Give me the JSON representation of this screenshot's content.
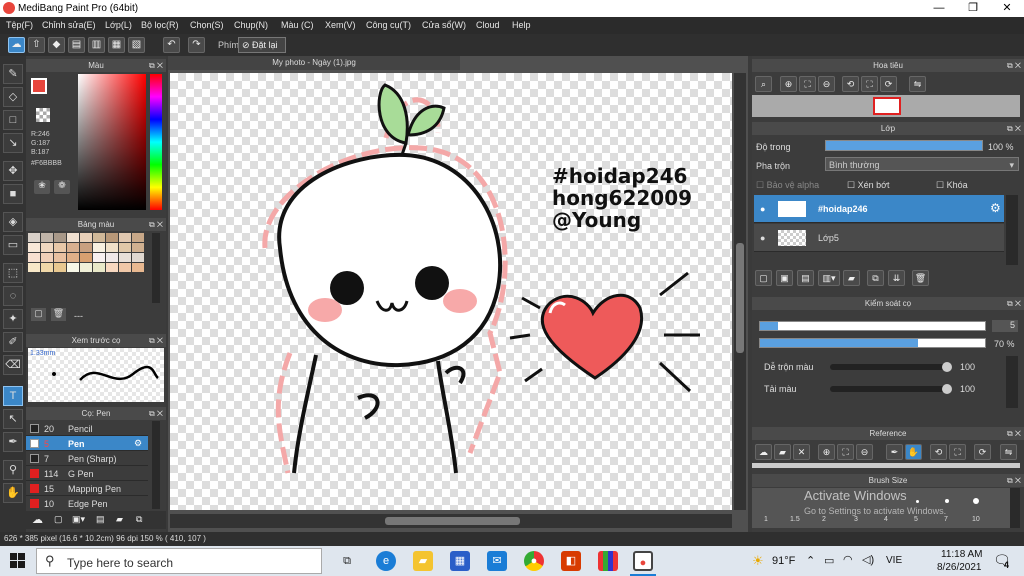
{
  "title": "MediBang Paint Pro (64bit)",
  "menu": [
    "Tệp(F)",
    "Chỉnh sửa(E)",
    "Lớp(L)",
    "Bộ lọc(R)",
    "Chọn(S)",
    "Chụp(N)",
    "Màu (C)",
    "Xem(V)",
    "Công cụ(T)",
    "Cửa sổ(W)",
    "Cloud",
    "Help"
  ],
  "toolbar": {
    "phim_label": "Phím",
    "reset_label": "Đặt lại"
  },
  "color_panel": {
    "title": "Màu",
    "rgb": [
      "R:246",
      "G:187",
      "B:187"
    ],
    "hex": "#F6BBBB",
    "main_color": "#e8453c"
  },
  "palette_panel": {
    "title": "Bảng màu",
    "dash": "---"
  },
  "preview_panel": {
    "title": "Xem trước cọ",
    "size": "1.33mm"
  },
  "brush_list": {
    "title": "Cọ: Pen",
    "items": [
      {
        "size": "20",
        "name": "Pencil",
        "color": "#222"
      },
      {
        "size": "5",
        "name": "Pen",
        "color": "#3b87c8",
        "selected": true
      },
      {
        "size": "7",
        "name": "Pen (Sharp)",
        "color": "#222"
      },
      {
        "size": "114",
        "name": "G Pen",
        "color": "#e02020"
      },
      {
        "size": "15",
        "name": "Mapping Pen",
        "color": "#e02020"
      },
      {
        "size": "10",
        "name": "Edge Pen",
        "color": "#e02020"
      }
    ]
  },
  "document": {
    "tab": "My photo - Ngày (1).jpg"
  },
  "artwork": {
    "lines": [
      "#hoidap246",
      "hong622009",
      "@Young"
    ]
  },
  "navigator": {
    "title": "Hoa tiêu"
  },
  "layer_panel": {
    "title": "Lớp",
    "opacity_label": "Độ trong",
    "opacity_value": "100 %",
    "blend_label": "Pha trộn",
    "blend_value": "Bình thường",
    "protect_alpha": "Bảo vệ alpha",
    "clip": "Xén bớt",
    "lock": "Khóa",
    "layers": [
      {
        "name": "#hoidap246",
        "selected": true
      },
      {
        "name": "Lớp5",
        "selected": false
      }
    ]
  },
  "brush_control": {
    "title": "Kiểm soát cọ",
    "size_value": "5",
    "opacity_value": "70 %",
    "mix_label": "Dễ trộn màu",
    "mix_value": "100",
    "paint_label": "Tải màu",
    "paint_value": "100"
  },
  "reference": {
    "title": "Reference"
  },
  "brush_size": {
    "title": "Brush Size",
    "sizes": [
      "1",
      "1.5",
      "2",
      "3",
      "4",
      "5",
      "7",
      "10"
    ]
  },
  "watermark": {
    "line1": "Activate Windows",
    "line2": "Go to Settings to activate Windows."
  },
  "status": {
    "text": "626 * 385 pixel   (16.6 * 10.2cm)   96 dpi   150 %   ( 410, 107 )"
  },
  "taskbar": {
    "search": "Type here to search",
    "weather": "91°F",
    "lang": "VIE",
    "time": "11:18 AM",
    "date": "8/26/2021",
    "notif": "4"
  }
}
